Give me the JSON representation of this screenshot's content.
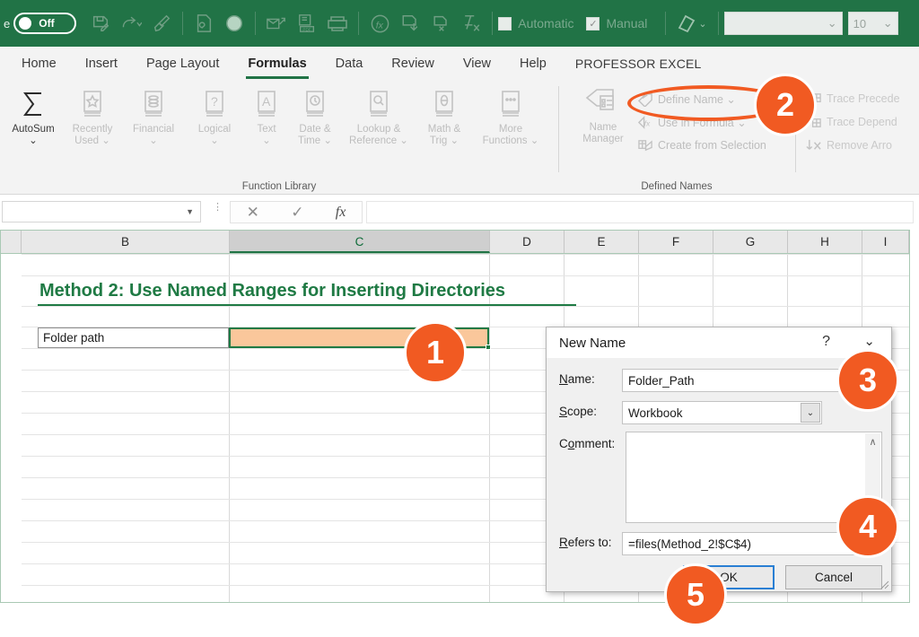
{
  "quick_access": {
    "left_text": "e",
    "toggle_label": "Off",
    "icons": [
      "save-icon",
      "redo-icon",
      "format-painter-icon",
      "page-icon",
      "record-icon",
      "email-icon",
      "pdf-icon",
      "print-icon",
      "function-icon",
      "save-as-icon",
      "export-icon",
      "formula-clear-icon"
    ],
    "calc_automatic": "Automatic",
    "calc_manual": "Manual",
    "shape_label": "shape-icon",
    "font_value": "",
    "font_size_value": "10"
  },
  "ribbon": {
    "tabs": [
      {
        "label": "Home",
        "active": false
      },
      {
        "label": "Insert",
        "active": false
      },
      {
        "label": "Page Layout",
        "active": false
      },
      {
        "label": "Formulas",
        "active": true
      },
      {
        "label": "Data",
        "active": false
      },
      {
        "label": "Review",
        "active": false
      },
      {
        "label": "View",
        "active": false
      },
      {
        "label": "Help",
        "active": false
      },
      {
        "label": "PROFESSOR EXCEL",
        "active": false
      }
    ],
    "function_library": {
      "group_label": "Function Library",
      "buttons": [
        {
          "label_line1": "AutoSum",
          "label_line2": "⌄",
          "icon": "sigma-icon",
          "enabled": true
        },
        {
          "label_line1": "Recently",
          "label_line2": "Used ⌄",
          "icon": "star-book-icon",
          "enabled": false
        },
        {
          "label_line1": "Financial",
          "label_line2": "⌄",
          "icon": "coins-book-icon",
          "enabled": false
        },
        {
          "label_line1": "Logical",
          "label_line2": "⌄",
          "icon": "question-book-icon",
          "enabled": false
        },
        {
          "label_line1": "Text",
          "label_line2": "⌄",
          "icon": "text-book-icon",
          "enabled": false
        },
        {
          "label_line1": "Date &",
          "label_line2": "Time ⌄",
          "icon": "clock-book-icon",
          "enabled": false
        },
        {
          "label_line1": "Lookup &",
          "label_line2": "Reference ⌄",
          "icon": "search-book-icon",
          "enabled": false
        },
        {
          "label_line1": "Math &",
          "label_line2": "Trig ⌄",
          "icon": "theta-book-icon",
          "enabled": false
        },
        {
          "label_line1": "More",
          "label_line2": "Functions ⌄",
          "icon": "more-book-icon",
          "enabled": false
        }
      ]
    },
    "defined_names": {
      "group_label": "Defined Names",
      "name_manager_line1": "Name",
      "name_manager_line2": "Manager",
      "items": [
        {
          "label": "Define Name ⌄",
          "icon": "tag-icon"
        },
        {
          "label": "Use in Formula ⌄",
          "icon": "fx-tag-icon"
        },
        {
          "label": "Create from Selection",
          "icon": "create-selection-icon"
        }
      ]
    },
    "formula_auditing": {
      "items": [
        {
          "label": "Trace Precede",
          "icon": "trace-precedents-icon"
        },
        {
          "label": "Trace Depend",
          "icon": "trace-dependents-icon"
        },
        {
          "label": "Remove Arro",
          "icon": "remove-arrows-icon"
        }
      ]
    }
  },
  "formula_bar": {
    "name_box_value": "",
    "cancel_icon": "cancel-x-icon",
    "enter_icon": "enter-check-icon",
    "function_icon": "insert-function-icon",
    "formula_value": ""
  },
  "sheet": {
    "columns": [
      "B",
      "C",
      "D",
      "E",
      "F",
      "G",
      "H",
      "I"
    ],
    "selected_column": "C",
    "title": "Method 2: Use Named Ranges for Inserting Directories",
    "label_cell": "Folder path",
    "selected_cell_value": ""
  },
  "dialog": {
    "title": "New Name",
    "help_glyph": "?",
    "minimize_glyph": "⌄",
    "name_label": "Name:",
    "name_value": "Folder_Path",
    "scope_label": "Scope:",
    "scope_value": "Workbook",
    "comment_label": "Comment:",
    "comment_value": "",
    "refers_to_label": "Refers to:",
    "refers_to_value": "=files(Method_2!$C$4)",
    "ok_label": "OK",
    "cancel_label": "Cancel"
  },
  "callouts": [
    {
      "number": "1"
    },
    {
      "number": "2"
    },
    {
      "number": "3"
    },
    {
      "number": "4"
    },
    {
      "number": "5"
    }
  ],
  "colors": {
    "excel_green": "#217346",
    "accent_orange": "#f15a22",
    "title_green": "#1f7a44",
    "cell_fill": "#fac79b"
  }
}
